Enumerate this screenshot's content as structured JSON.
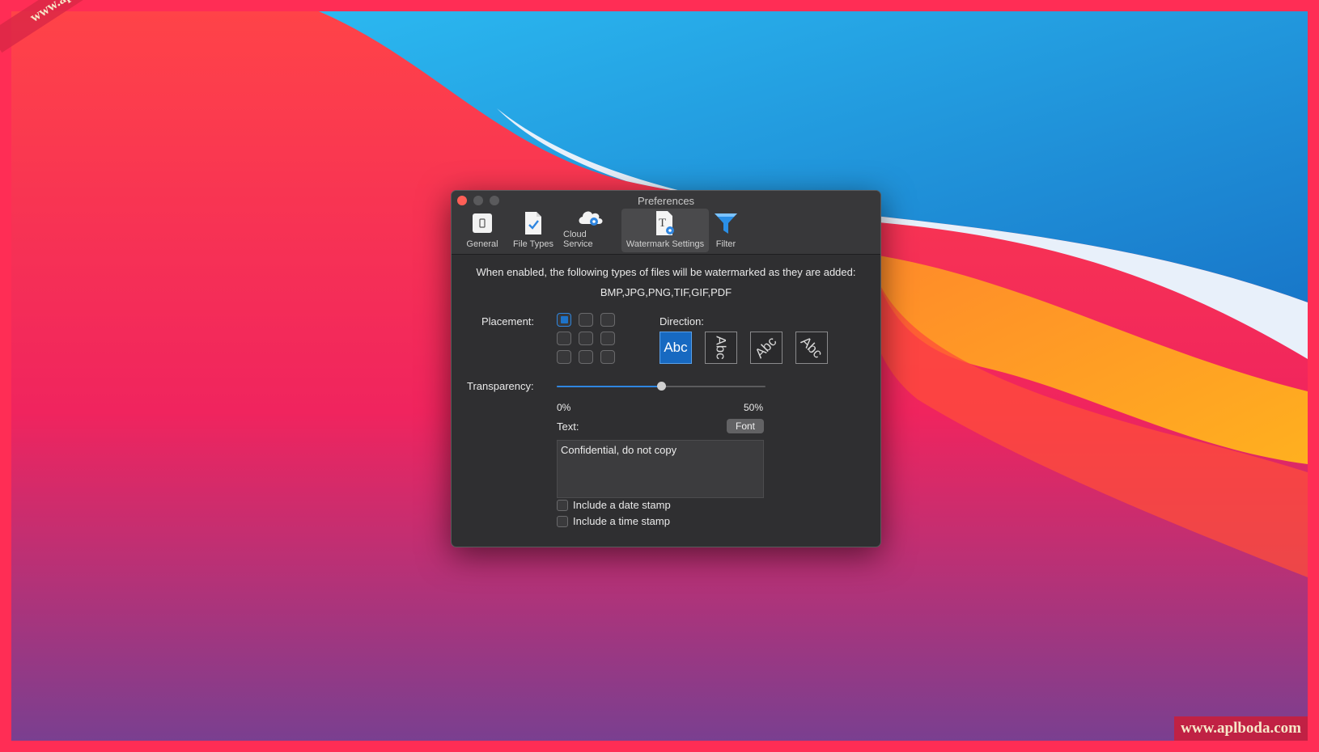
{
  "window": {
    "title": "Preferences",
    "toolbar": [
      {
        "label": "General",
        "icon": "general-icon"
      },
      {
        "label": "File Types",
        "icon": "file-types-icon"
      },
      {
        "label": "Cloud Service",
        "icon": "cloud-service-icon"
      },
      {
        "label": "Watermark Settings",
        "icon": "watermark-settings-icon",
        "active": true
      },
      {
        "label": "Filter",
        "icon": "filter-icon"
      }
    ]
  },
  "watermark": {
    "intro": "When enabled, the following types of files will be watermarked as they are added:",
    "file_types": "BMP,JPG,PNG,TIF,GIF,PDF",
    "placement_label": "Placement:",
    "placement_selected_index": 0,
    "direction_label": "Direction:",
    "direction_sample": "Abc",
    "direction_selected_index": 0,
    "transparency_label": "Transparency:",
    "transparency_value": 0.5,
    "transparency_min_label": "0%",
    "transparency_max_label": "50%",
    "text_label": "Text:",
    "font_button": "Font",
    "text_value": "Confidential, do not copy",
    "date_stamp_label": "Include a date stamp",
    "date_stamp_checked": false,
    "time_stamp_label": "Include a time stamp",
    "time_stamp_checked": false
  },
  "overlay": {
    "corner_watermark": "www.aplboda.com",
    "bottom_watermark": "www.aplboda.com"
  },
  "colors": {
    "accent": "#1769c1",
    "close": "#ff5f57"
  }
}
